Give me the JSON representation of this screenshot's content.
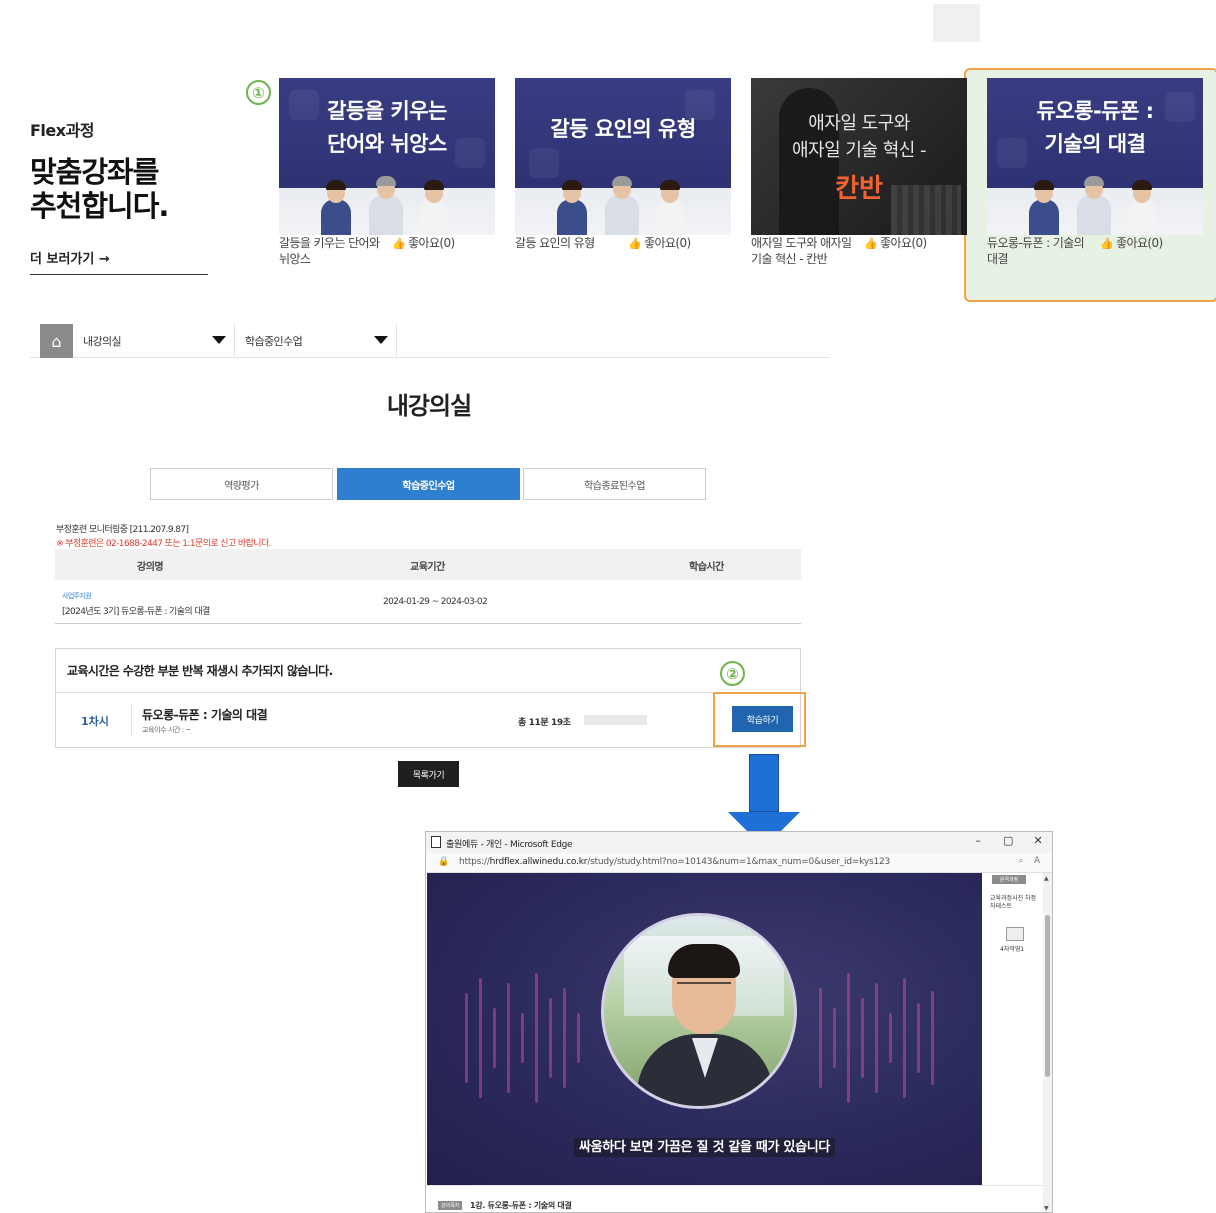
{
  "recommend": {
    "category": "Flex과정",
    "headline_line1": "맞춤강좌를",
    "headline_line2": "추천합니다.",
    "more_label": "더 보러가기 →",
    "step_marker": "①",
    "cards": [
      {
        "thumb_line1": "갈등을 키우는",
        "thumb_line2": "단어와 뉘앙스",
        "title": "갈등을 키우는 단어와 뉘앙스",
        "like": "좋아요(0)"
      },
      {
        "thumb_line1": "갈등 요인의 유형",
        "thumb_line2": "",
        "title": "갈등 요인의 유형",
        "like": "좋아요(0)"
      },
      {
        "thumb_line1": "애자일 도구와",
        "thumb_line2": "애자일 기술 혁신 -",
        "thumb_accent": "칸반",
        "title": "애자일 도구와 애자일 기술 혁신 - 칸반",
        "like": "좋아요(0)"
      },
      {
        "thumb_line1": "듀오롱-듀폰 :",
        "thumb_line2": "기술의 대결",
        "title": "듀오롱-듀폰 : 기술의 대결",
        "like": "좋아요(0)"
      }
    ]
  },
  "nav": {
    "home_icon": "home-icon",
    "item1": "내강의실",
    "item2": "학습중인수업"
  },
  "page_title": "내강의실",
  "tabs": [
    "역량평가",
    "학습중인수업",
    "학습종료된수업"
  ],
  "monitor_text": "부정훈련 모니터링중 [211.207.9.87]",
  "warning_text": "※ 부정훈련은 02-1688-2447 또는 1:1문의로 신고 바랍니다.",
  "table": {
    "headers": [
      "강의명",
      "교육기간",
      "학습시간"
    ],
    "row": {
      "badge": "사업주지원",
      "name": "[2024년도 3기] 듀오롱-듀폰 : 기술의 대결",
      "period": "2024-01-29 ~ 2024-03-02"
    }
  },
  "lesson": {
    "note": "교육시간은 수강한 부분 반복 재생시 추가되지 않습니다.",
    "step_marker": "②",
    "no": "1차시",
    "name": "듀오롱-듀폰 : 기술의 대결",
    "sub": "교육이수 시간 : ~",
    "time": "총 11분 19초",
    "study_button": "학습하기"
  },
  "list_button": "목록가기",
  "arrow_color": "#1e6fd6",
  "browser": {
    "title": "출원에듀 - 개인 - Microsoft Edge",
    "url_prefix": "https://",
    "url_host": "hrdflex.allwinedu.co.kr",
    "url_path": "/study/study.html?no=10143&num=1&max_num=0&user_id=kys123",
    "controls": [
      "–",
      "▢",
      "✕"
    ],
    "subtitle": "싸움하다 보면 가끔은 질 것 같을 때가 있습니다",
    "side_tag": "원격과정",
    "side_image_alt": "교육과정사진 차정자테스트",
    "side_num": "4자막영1",
    "footer_tag": "강의목차",
    "footer_title": "1강. 듀오롱-듀폰 : 기술의 대결"
  },
  "colors": {
    "accent_blue": "#2f7fd0",
    "step_green": "#6fb34e",
    "highlight_orange": "#f0a44a",
    "highlight_bg": "#e8f2e4"
  }
}
